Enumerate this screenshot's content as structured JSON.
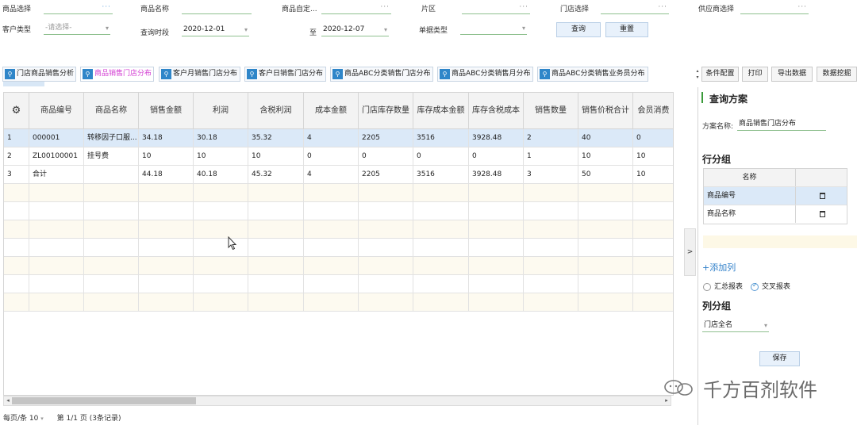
{
  "filters": {
    "product_select": {
      "label": "商品选择",
      "value": ""
    },
    "product_name": {
      "label": "商品名称",
      "value": ""
    },
    "product_custom": {
      "label": "商品自定...",
      "value": ""
    },
    "area": {
      "label": "片区",
      "value": ""
    },
    "store_select": {
      "label": "门店选择",
      "value": ""
    },
    "supplier_select": {
      "label": "供应商选择",
      "value": ""
    },
    "customer_type": {
      "label": "客户类型",
      "placeholder": "-请选择-"
    },
    "query_period": {
      "label": "查询时段",
      "from": "2020-12-01",
      "to_label": "至",
      "to": "2020-12-07"
    },
    "doc_type": {
      "label": "单据类型",
      "value": ""
    },
    "query_button": "查询",
    "reset_button": "重置"
  },
  "tabs": [
    {
      "label": "门店商品销售分析",
      "active": false
    },
    {
      "label": "商品销售门店分布",
      "active": true
    },
    {
      "label": "客户月销售门店分布",
      "active": false
    },
    {
      "label": "客户日销售门店分布",
      "active": false
    },
    {
      "label": "商品ABC分类销售门店分布",
      "active": false
    },
    {
      "label": "商品ABC分类销售月分布",
      "active": false
    },
    {
      "label": "商品ABC分类销售业务员分布",
      "active": false
    }
  ],
  "toolbar": {
    "config": "条件配置",
    "print": "打印",
    "export": "导出数据",
    "mining": "数据挖掘"
  },
  "grid": {
    "columns": [
      "商品编号",
      "商品名称",
      "销售金额",
      "利润",
      "含税利润",
      "成本金额",
      "门店库存数量",
      "库存成本金额",
      "库存含税成本",
      "销售数量",
      "销售价税合计",
      "会员消费"
    ],
    "rows": [
      [
        "1",
        "000001",
        "转移因子口服...",
        "34.18",
        "30.18",
        "35.32",
        "4",
        "2205",
        "3516",
        "3928.48",
        "2",
        "40",
        "0"
      ],
      [
        "2",
        "ZL00100001",
        "挂号费",
        "10",
        "10",
        "10",
        "0",
        "0",
        "0",
        "0",
        "1",
        "10",
        "10"
      ],
      [
        "3",
        "合计",
        "",
        "44.18",
        "40.18",
        "45.32",
        "4",
        "2205",
        "3516",
        "3928.48",
        "3",
        "50",
        "10"
      ]
    ]
  },
  "pager": {
    "per_page_label": "每页/条",
    "per_page": "10",
    "page_info": "第 1/1 页 (3条记录)"
  },
  "panel": {
    "title": "查询方案",
    "scheme_label": "方案名称:",
    "scheme_value": "商品销售门店分布",
    "row_group_title": "行分组",
    "row_group_header": "名称",
    "row_group_items": [
      "商品编号",
      "商品名称"
    ],
    "add_column": "+添加列",
    "summary_report": "汇总报表",
    "cross_report": "交叉报表",
    "col_group_title": "列分组",
    "col_group_value": "门店全名",
    "save_button": "保存",
    "collapse_arrow": ">"
  },
  "watermark": "千方百剂软件"
}
